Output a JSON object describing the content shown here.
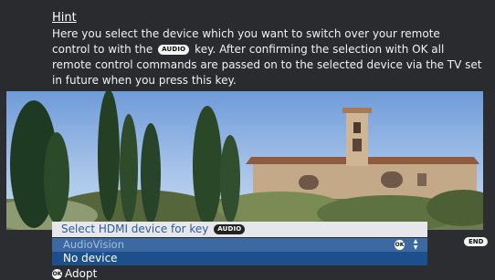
{
  "hint": {
    "title": "Hint",
    "line1": "Here you select the device which you want to switch over your remote",
    "line2_before": "control to with the",
    "key_label": "AUDIO",
    "line2_after": "key. After confirming the selection with OK all",
    "line3": "remote control commands are passed on to the selected device via the TV set",
    "line4": "in future when you press this key."
  },
  "menu": {
    "title": "Select HDMI device for key",
    "title_key": "AUDIO",
    "items": [
      {
        "label": "AudioVision",
        "state": "unavailable"
      },
      {
        "label": "No device",
        "state": "selected"
      }
    ],
    "ok_key": "OK",
    "adopt_label": "Adopt"
  },
  "footer": {
    "end_key": "END"
  },
  "colors": {
    "panel": "#2a2b2e",
    "menu_title_bg": "#e6e7ea",
    "menu_title_text": "#2f5b93",
    "highlight": "#3d69a3",
    "selected": "#1d4f8c"
  },
  "icons": [
    "ok-icon",
    "up-down-arrows-icon",
    "end-key-icon",
    "audio-key-icon"
  ]
}
